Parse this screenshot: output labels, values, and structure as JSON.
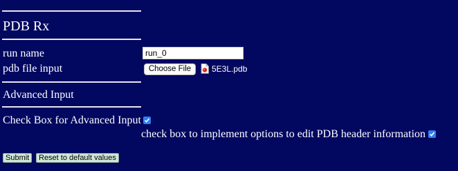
{
  "form": {
    "title": "PDB Rx",
    "run_name_label": "run name",
    "run_name_value": "run_0",
    "pdb_file_label": "pdb file input",
    "choose_file_label": "Choose File",
    "chosen_file_name": "5E3L.pdb",
    "advanced_heading": "Advanced Input",
    "advanced_checkbox_label": "Check Box for Advanced Input",
    "advanced_checked": true,
    "header_checkbox_label": "check box to implement options to edit PDB header information",
    "header_checked": true,
    "submit_label": "Submit",
    "reset_label": "Reset to default values"
  },
  "colors": {
    "background": "#020760",
    "checkbox": "#2f7ff5"
  },
  "icons": {
    "file": "pdb-file-icon"
  }
}
